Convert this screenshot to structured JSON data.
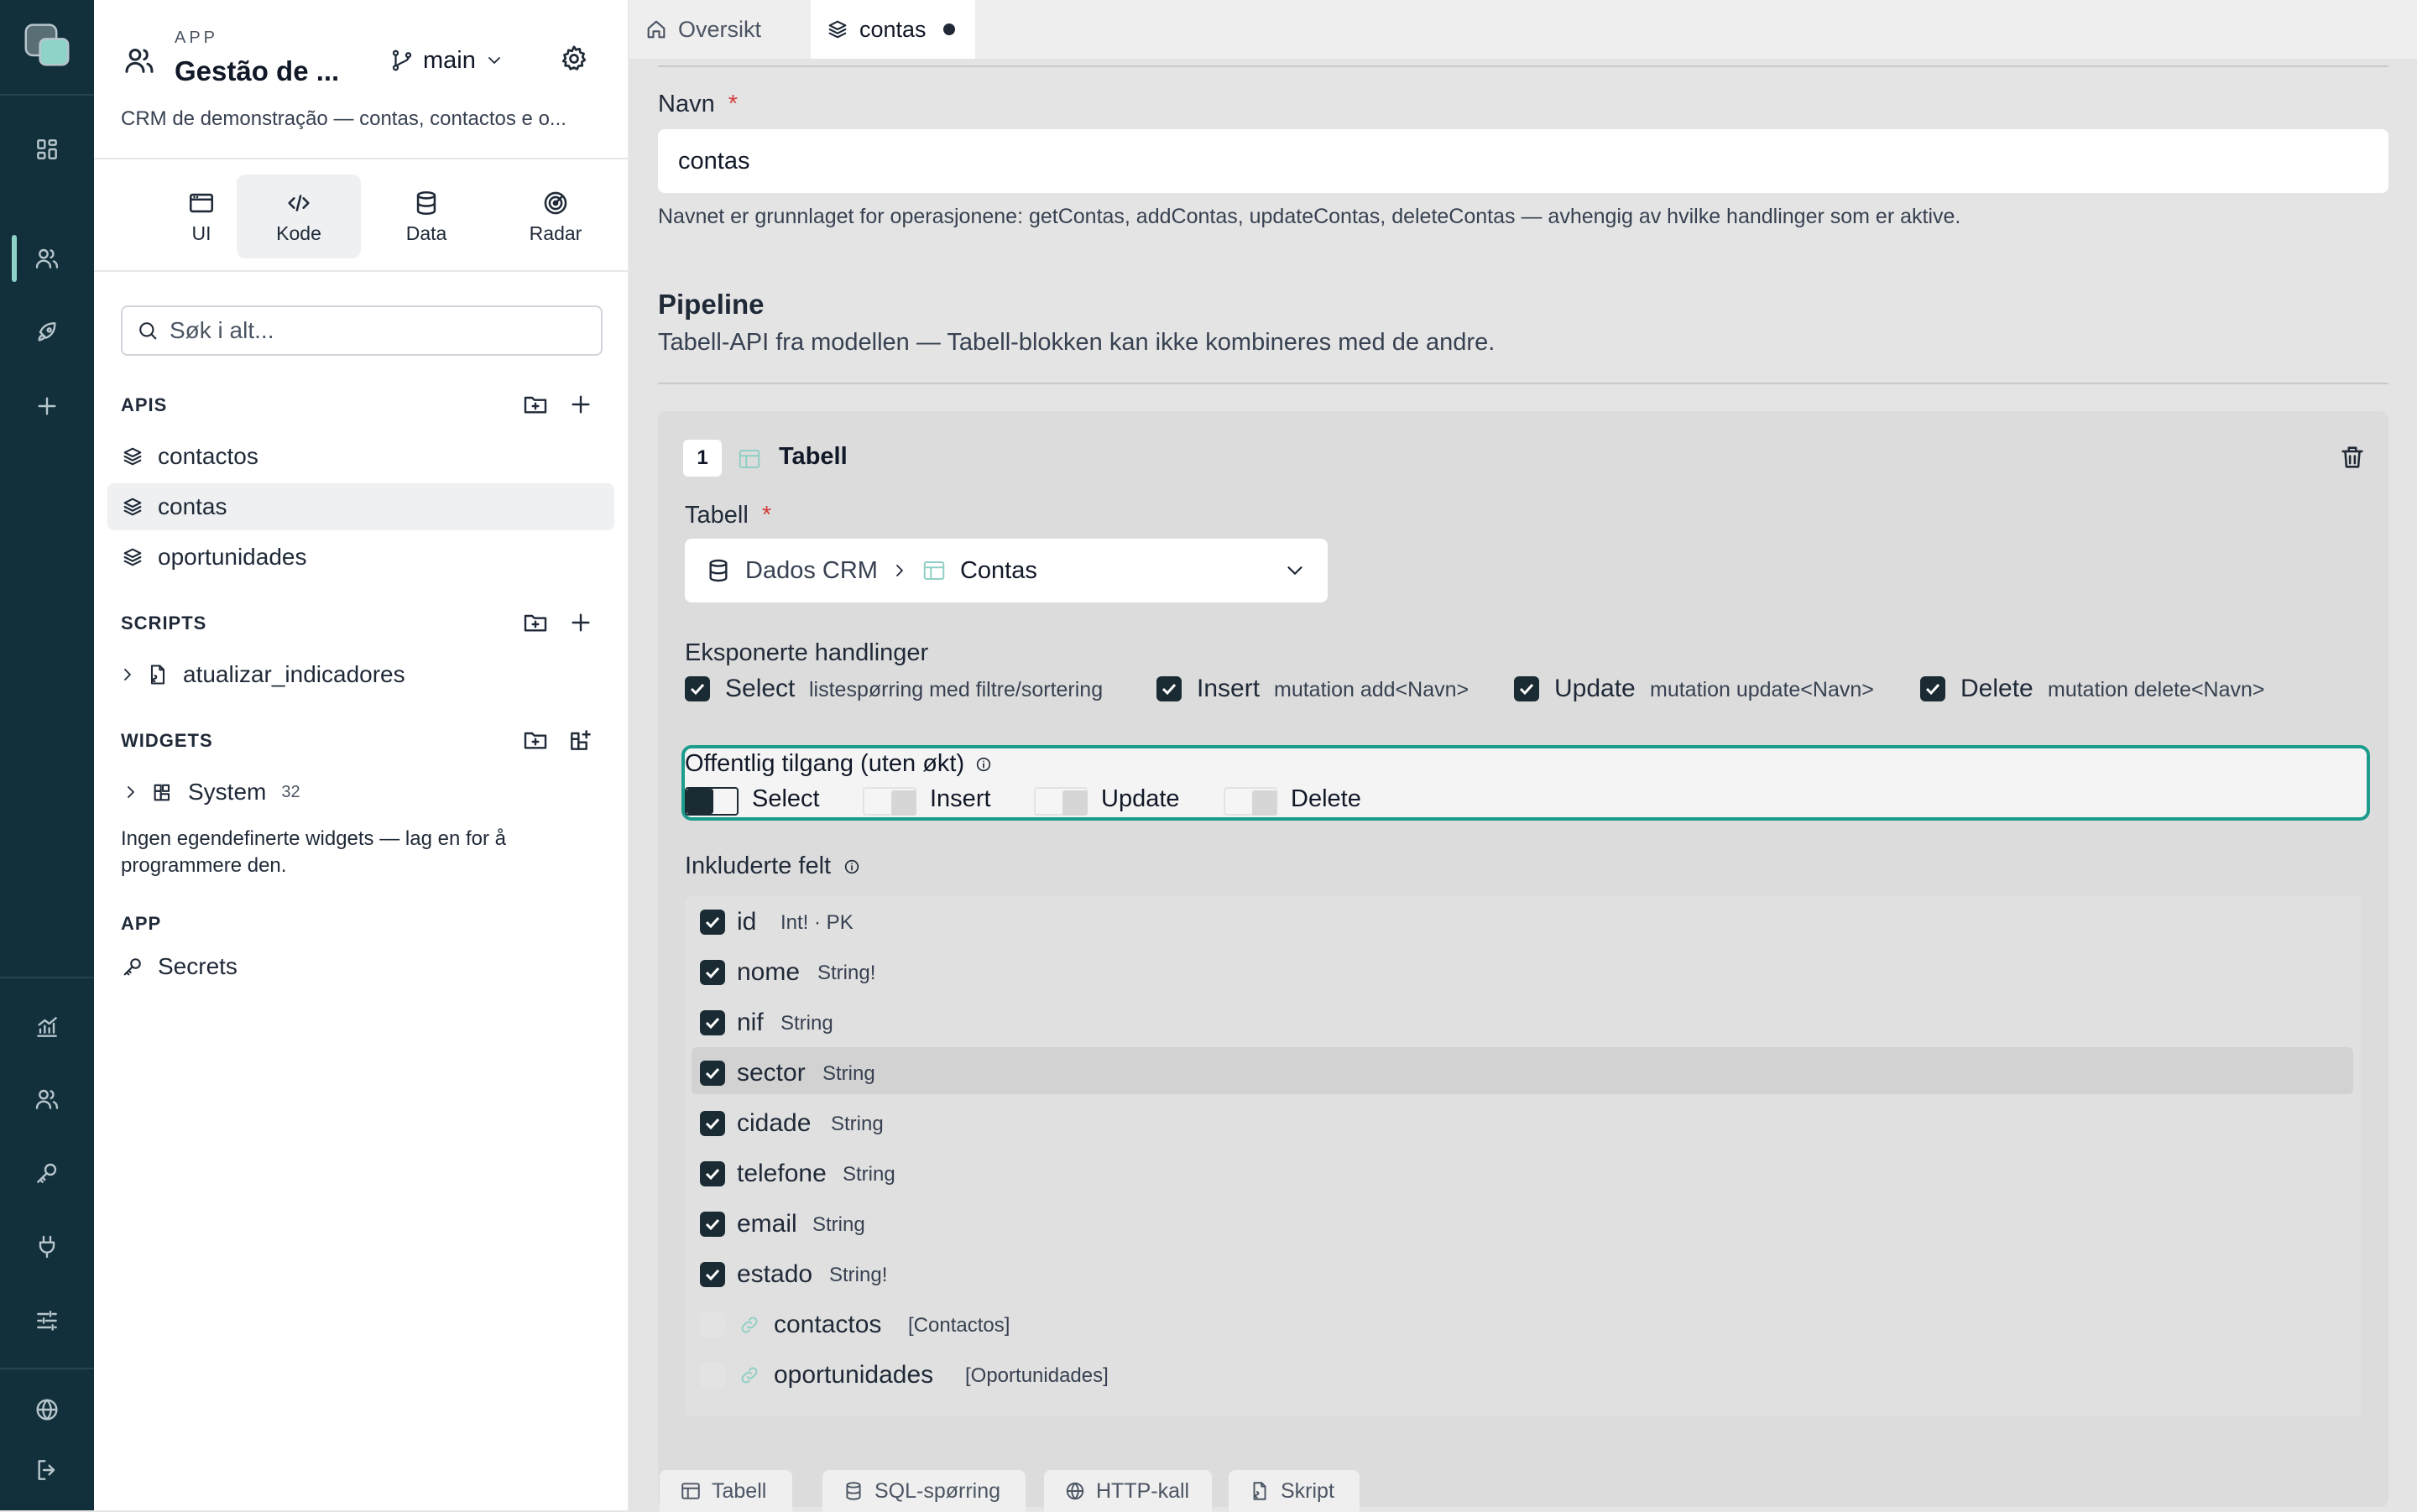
{
  "app": {
    "section_label": "APP",
    "name": "Gestão de ...",
    "description": "CRM de demonstração — contas, contactos e o...",
    "branch": "main"
  },
  "modes": [
    {
      "label": "UI",
      "icon": "window-icon"
    },
    {
      "label": "Kode",
      "icon": "code-icon"
    },
    {
      "label": "Data",
      "icon": "database-icon"
    },
    {
      "label": "Radar",
      "icon": "radar-icon"
    }
  ],
  "search": {
    "placeholder": "Søk i alt..."
  },
  "sections": {
    "apis": {
      "title": "APIS",
      "items": [
        "contactos",
        "contas",
        "oportunidades"
      ],
      "active": "contas"
    },
    "scripts": {
      "title": "SCRIPTS",
      "items": [
        "atualizar_indicadores"
      ]
    },
    "widgets": {
      "title": "WIDGETS",
      "group": "System",
      "count": "32",
      "empty_text_1": "Ingen egendefinerte widgets — lag en for å",
      "empty_text_2": "programmere den."
    },
    "app": {
      "title": "APP",
      "items": [
        "Secrets"
      ]
    }
  },
  "tabs": [
    {
      "label": "Oversikt",
      "icon": "home-icon"
    },
    {
      "label": "contas",
      "icon": "layers-icon",
      "modified": true
    }
  ],
  "form": {
    "name_label": "Navn",
    "required_mark": "*",
    "name_value": "contas",
    "name_help": "Navnet er grunnlaget for operasjonene: getContas, addContas, updateContas, deleteContas — avhengig av hvilke handlinger som er aktive.",
    "pipeline_title": "Pipeline",
    "pipeline_desc": "Tabell-API fra modellen — Tabell-blokken kan ikke kombineres med de andre."
  },
  "block": {
    "index": "1",
    "title": "Tabell",
    "table_label": "Tabell",
    "source": "Dados CRM",
    "table": "Contas",
    "actions_label": "Eksponerte handlinger",
    "actions": [
      {
        "name": "Select",
        "desc": "listespørring med filtre/sortering",
        "checked": true
      },
      {
        "name": "Insert",
        "desc": "mutation add<Navn>",
        "checked": true
      },
      {
        "name": "Update",
        "desc": "mutation update<Navn>",
        "checked": true
      },
      {
        "name": "Delete",
        "desc": "mutation delete<Navn>",
        "checked": true
      }
    ],
    "public_label": "Offentlig tilgang (uten økt)",
    "public": [
      {
        "name": "Select",
        "on": true
      },
      {
        "name": "Insert",
        "on": false
      },
      {
        "name": "Update",
        "on": false
      },
      {
        "name": "Delete",
        "on": false
      }
    ],
    "fields_label": "Inkluderte felt",
    "fields": [
      {
        "name": "id",
        "type": "Int! · PK",
        "checked": true
      },
      {
        "name": "nome",
        "type": "String!",
        "checked": true
      },
      {
        "name": "nif",
        "type": "String",
        "checked": true
      },
      {
        "name": "sector",
        "type": "String",
        "checked": true
      },
      {
        "name": "cidade",
        "type": "String",
        "checked": true
      },
      {
        "name": "telefone",
        "type": "String",
        "checked": true
      },
      {
        "name": "email",
        "type": "String",
        "checked": true
      },
      {
        "name": "estado",
        "type": "String!",
        "checked": true
      }
    ],
    "relations": [
      {
        "name": "contactos",
        "type": "[Contactos]"
      },
      {
        "name": "oportunidades",
        "type": "[Oportunidades]"
      }
    ]
  },
  "add_blocks": [
    {
      "label": "Tabell",
      "icon": "table-icon"
    },
    {
      "label": "SQL-spørring",
      "icon": "database-icon"
    },
    {
      "label": "HTTP-kall",
      "icon": "globe-icon"
    },
    {
      "label": "Skript",
      "icon": "script-icon"
    }
  ],
  "colors": {
    "rail": "#12303b",
    "accent": "#1c9c8c",
    "checkbox": "#1b2b33",
    "danger": "#d43b3b"
  }
}
